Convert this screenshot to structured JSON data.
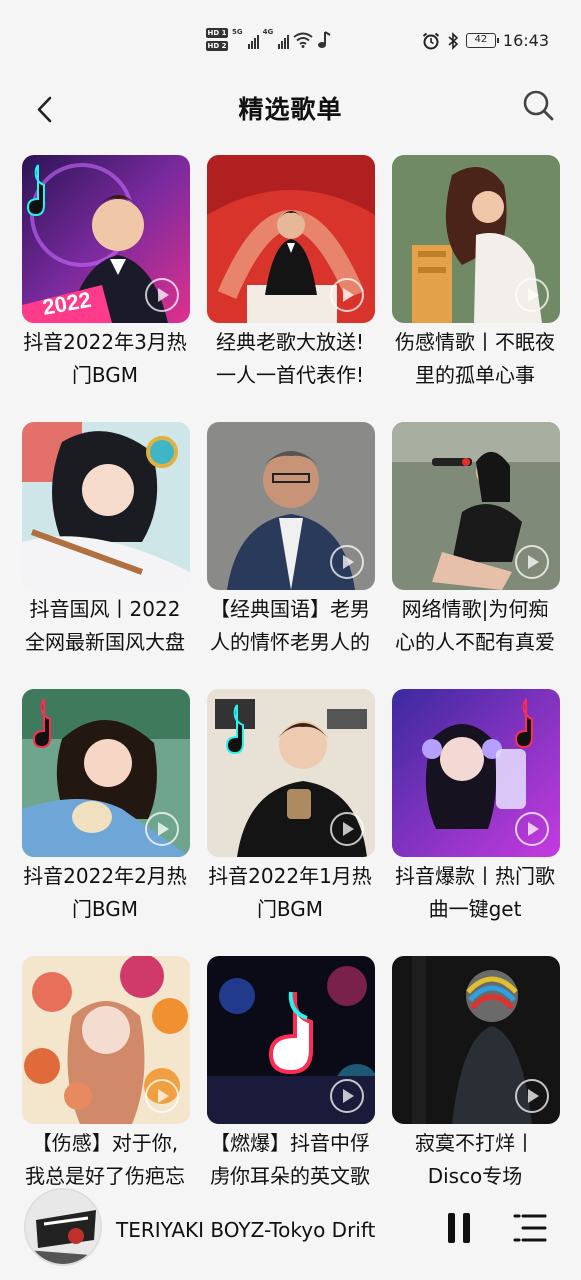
{
  "status_bar": {
    "hd1": "HD 1",
    "hd2": "HD 2",
    "net1": "5G",
    "net2": "4G",
    "battery": "42",
    "time": "16:43",
    "icons": [
      "alarm-icon",
      "bluetooth-icon",
      "wifi-icon",
      "music-note-icon"
    ]
  },
  "header": {
    "title": "精选歌单",
    "back_icon": "chevron-left-icon",
    "search_icon": "search-icon"
  },
  "playlists": [
    {
      "line1": "抖音2022年3月热",
      "line2": "门BGM"
    },
    {
      "line1": "经典老歌大放送!",
      "line2": "一人一首代表作!"
    },
    {
      "line1": "伤感情歌丨不眠夜",
      "line2": "里的孤单心事"
    },
    {
      "line1": "抖音国风丨2022",
      "line2": "全网最新国风大盘"
    },
    {
      "line1": "【经典国语】老男",
      "line2": "人的情怀老男人的"
    },
    {
      "line1": "网络情歌|为何痴",
      "line2": "心的人不配有真爱"
    },
    {
      "line1": "抖音2022年2月热",
      "line2": "门BGM"
    },
    {
      "line1": "抖音2022年1月热",
      "line2": "门BGM"
    },
    {
      "line1": "抖音爆款丨热门歌",
      "line2": "曲一键get"
    },
    {
      "line1": "【伤感】对于你,",
      "line2": "我总是好了伤疤忘"
    },
    {
      "line1": "【燃爆】抖音中俘",
      "line2": "虏你耳朵的英文歌"
    },
    {
      "line1": "寂寞不打烊丨",
      "line2": "Disco专场"
    }
  ],
  "player": {
    "track": "TERIYAKI BOYZ-Tokyo Drift",
    "pause_icon": "pause-icon",
    "playlist_icon": "playlist-icon"
  },
  "colors": {
    "background": "#f5f5f5",
    "text": "#111111"
  }
}
